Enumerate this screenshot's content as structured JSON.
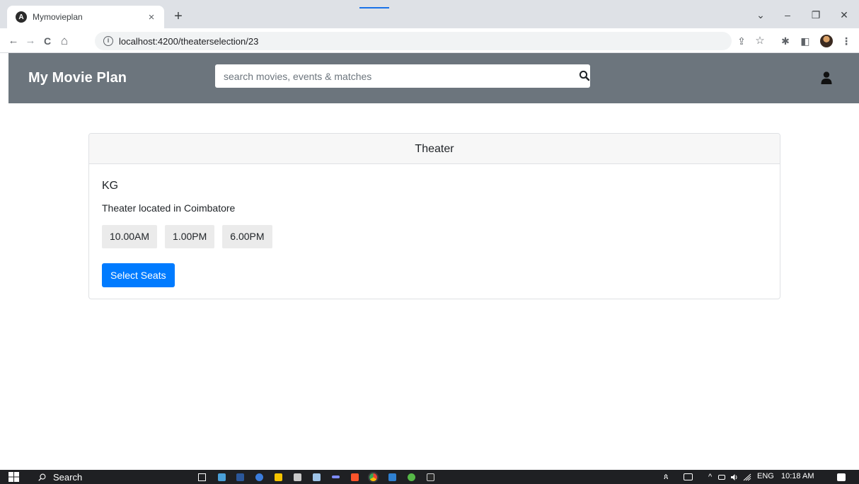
{
  "browser": {
    "tab_title": "Mymovieplan",
    "favicon_letter": "A",
    "close_glyph": "×",
    "newtab_glyph": "+",
    "url": "localhost:4200/theaterselection/23",
    "window_controls": [
      "⌄",
      "–",
      "❐",
      "✕"
    ],
    "nav": {
      "back": "←",
      "forward": "→",
      "reload": "C",
      "home": "⌂"
    },
    "info_glyph": "i",
    "toolbar_icons": [
      "share-icon",
      "star-icon",
      "extensions-icon",
      "sidepanel-icon",
      "profile-avatar",
      "menu-icon"
    ],
    "toolbar_glyphs": {
      "share": "⇪",
      "star": "☆",
      "extensions": "✱",
      "sidepanel": "◧",
      "menu": "⋮"
    }
  },
  "navbar": {
    "brand": "My Movie Plan",
    "search_placeholder": "search movies, events & matches",
    "background": "#6c757d"
  },
  "theater": {
    "header": "Theater",
    "name": "KG",
    "description": "Theater located in Coimbatore",
    "showtimes": [
      "10.00AM",
      "1.00PM",
      "6.00PM"
    ],
    "select_label": "Select Seats",
    "primary_color": "#007bff"
  },
  "taskbar": {
    "search_label": "Search",
    "language": "ENG",
    "time": "10:18 AM",
    "tray_glyphs": {
      "people": "ጰ",
      "chevron": "^"
    },
    "apps": [
      "task-view-icon",
      "file-explorer-icon",
      "word-icon",
      "chat-icon",
      "sticky-notes-icon",
      "paint-icon",
      "notepad-icon",
      "app-icon",
      "brave-icon",
      "chrome-icon",
      "vscode-icon",
      "spotify-icon",
      "terminal-icon"
    ]
  }
}
